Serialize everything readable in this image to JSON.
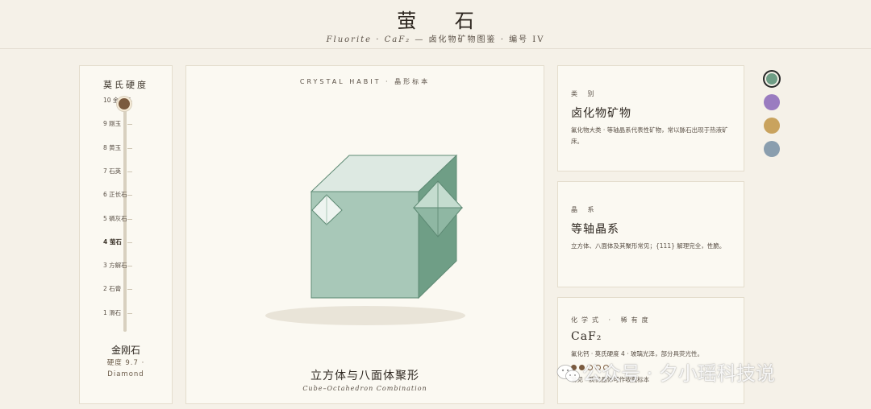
{
  "header": {
    "title": "萤 石",
    "subtitle_latin": "Fluorite · CaF₂",
    "subtitle_rest": " — 卤化物矿物图鉴 · 编号 IV"
  },
  "hardness_scale": {
    "title": "莫氏硬度",
    "ticks": [
      {
        "label": "10 金刚石",
        "value": 10
      },
      {
        "label": "9 刚玉",
        "value": 9
      },
      {
        "label": "8 黄玉",
        "value": 8
      },
      {
        "label": "7 石英",
        "value": 7
      },
      {
        "label": "6 正长石",
        "value": 6
      },
      {
        "label": "5 磷灰石",
        "value": 5
      },
      {
        "label": "4 萤石",
        "value": 4
      },
      {
        "label": "3 方解石",
        "value": 3
      },
      {
        "label": "2 石膏",
        "value": 2
      },
      {
        "label": "1 滑石",
        "value": 1
      }
    ],
    "selected_value": 10,
    "active_mark": "4 萤石",
    "selected_name": "金刚石",
    "selected_detail": "硬度 9.7 ·",
    "selected_latin": "Diamond",
    "knob_color": "#7a5a3e"
  },
  "specimen": {
    "habit_label": "CRYSTAL HABIT · 晶形标本",
    "form_name": "立方体与八面体聚形",
    "form_latin": "Cube–Octahedron Combination",
    "crystal_color": "#a8c8b8"
  },
  "cards": [
    {
      "label": "类 别",
      "value": "卤化物矿物",
      "desc": "氟化物大类 · 等轴晶系代表性矿物，常以脉石出现于热液矿床。"
    },
    {
      "label": "晶 系",
      "value": "等轴晶系",
      "desc": "立方体、八面体及其聚形常见；{111} 解理完全，性脆。"
    },
    {
      "label": "化学式 · 稀有度",
      "value": "CaF₂",
      "desc": "氟化钙 · 莫氏硬度 4 · 玻璃光泽，部分具荧光性。",
      "rarity_filled": 2,
      "rarity_total": 5,
      "note": "常见 · 质优晶体可作收藏标本"
    }
  ],
  "swatches": [
    {
      "name": "green",
      "color": "#6f9e86",
      "selected": true
    },
    {
      "name": "purple",
      "color": "#9a7cc0",
      "selected": false
    },
    {
      "name": "gold",
      "color": "#c9a35e",
      "selected": false
    },
    {
      "name": "slate",
      "color": "#8a9eae",
      "selected": false
    }
  ],
  "watermark": {
    "text": "公众号 · 夕小瑶科技说",
    "icon": "wechat-icon"
  }
}
